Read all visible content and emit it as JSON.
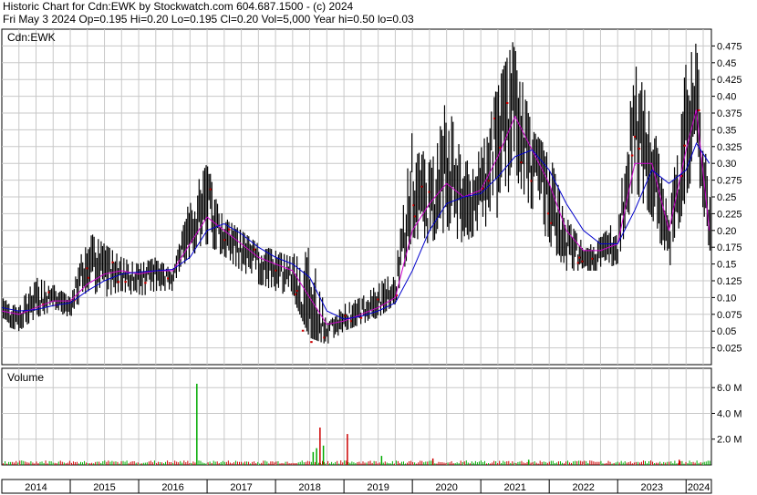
{
  "header": {
    "line1": "Historic Chart for Cdn:EWK by Stockwatch.com 604.687.1500 - (c) 2024",
    "line2": "Fri May  3 2024  Op=0.195  Hi=0.20  Lo=0.195  Cl=0.20  Vol=5,000  Year hi=0.50  lo=0.03"
  },
  "chart_data": [
    {
      "type": "line",
      "title": "",
      "symbol_label": "Cdn:EWK",
      "y_axis_side": "right",
      "ylim": [
        0,
        0.5
      ],
      "y_ticks": [
        0.025,
        0.05,
        0.075,
        0.1,
        0.125,
        0.15,
        0.175,
        0.2,
        0.225,
        0.25,
        0.275,
        0.3,
        0.325,
        0.35,
        0.375,
        0.4,
        0.425,
        0.45,
        0.475
      ],
      "y_tick_labels": [
        "0.025",
        "0.05",
        "0.075",
        "0.10",
        "0.125",
        "0.15",
        "0.175",
        "0.20",
        "0.225",
        "0.25",
        "0.275",
        "0.30",
        "0.325",
        "0.35",
        "0.375",
        "0.40",
        "0.425",
        "0.45",
        "0.475"
      ],
      "x": [
        2014.0,
        2014.25,
        2014.5,
        2014.75,
        2015.0,
        2015.25,
        2015.5,
        2015.75,
        2016.0,
        2016.25,
        2016.5,
        2016.75,
        2017.0,
        2017.25,
        2017.5,
        2017.75,
        2018.0,
        2018.25,
        2018.5,
        2018.75,
        2019.0,
        2019.25,
        2019.5,
        2019.75,
        2020.0,
        2020.25,
        2020.5,
        2020.75,
        2021.0,
        2021.25,
        2021.5,
        2021.75,
        2022.0,
        2022.25,
        2022.5,
        2022.75,
        2023.0,
        2023.25,
        2023.5,
        2023.75,
        2024.0,
        2024.15,
        2024.34
      ],
      "series": [
        {
          "kind": "price_bars",
          "high": [
            0.11,
            0.09,
            0.13,
            0.12,
            0.1,
            0.2,
            0.18,
            0.16,
            0.15,
            0.16,
            0.14,
            0.25,
            0.3,
            0.22,
            0.2,
            0.18,
            0.17,
            0.16,
            0.22,
            0.06,
            0.09,
            0.1,
            0.12,
            0.14,
            0.35,
            0.3,
            0.4,
            0.3,
            0.32,
            0.42,
            0.49,
            0.35,
            0.32,
            0.22,
            0.18,
            0.19,
            0.22,
            0.45,
            0.38,
            0.22,
            0.45,
            0.48,
            0.25
          ],
          "low": [
            0.06,
            0.05,
            0.07,
            0.08,
            0.07,
            0.11,
            0.1,
            0.11,
            0.1,
            0.11,
            0.11,
            0.16,
            0.18,
            0.16,
            0.14,
            0.12,
            0.11,
            0.1,
            0.04,
            0.03,
            0.05,
            0.06,
            0.07,
            0.09,
            0.19,
            0.18,
            0.2,
            0.18,
            0.2,
            0.22,
            0.28,
            0.23,
            0.18,
            0.14,
            0.14,
            0.14,
            0.15,
            0.26,
            0.22,
            0.14,
            0.25,
            0.3,
            0.17
          ],
          "close": [
            0.08,
            0.07,
            0.1,
            0.1,
            0.09,
            0.15,
            0.14,
            0.14,
            0.13,
            0.14,
            0.13,
            0.21,
            0.24,
            0.19,
            0.17,
            0.15,
            0.14,
            0.13,
            0.06,
            0.05,
            0.07,
            0.08,
            0.09,
            0.11,
            0.27,
            0.23,
            0.3,
            0.24,
            0.26,
            0.33,
            0.38,
            0.3,
            0.25,
            0.18,
            0.16,
            0.17,
            0.18,
            0.35,
            0.29,
            0.18,
            0.35,
            0.39,
            0.2
          ]
        },
        {
          "kind": "moving_average",
          "color": "#cc00cc",
          "values": [
            0.08,
            0.075,
            0.085,
            0.095,
            0.095,
            0.12,
            0.135,
            0.14,
            0.135,
            0.14,
            0.14,
            0.18,
            0.22,
            0.2,
            0.18,
            0.16,
            0.15,
            0.14,
            0.1,
            0.06,
            0.065,
            0.075,
            0.085,
            0.1,
            0.2,
            0.24,
            0.27,
            0.25,
            0.26,
            0.31,
            0.37,
            0.32,
            0.27,
            0.2,
            0.17,
            0.17,
            0.18,
            0.3,
            0.3,
            0.2,
            0.32,
            0.38,
            0.2
          ]
        },
        {
          "kind": "moving_average",
          "color": "#0000cc",
          "values": [
            0.085,
            0.08,
            0.082,
            0.088,
            0.092,
            0.11,
            0.125,
            0.135,
            0.138,
            0.14,
            0.142,
            0.16,
            0.2,
            0.21,
            0.195,
            0.175,
            0.16,
            0.15,
            0.13,
            0.08,
            0.068,
            0.072,
            0.08,
            0.092,
            0.14,
            0.2,
            0.24,
            0.25,
            0.255,
            0.28,
            0.31,
            0.32,
            0.29,
            0.24,
            0.2,
            0.18,
            0.18,
            0.23,
            0.29,
            0.27,
            0.29,
            0.33,
            0.3
          ]
        }
      ],
      "grid": true
    },
    {
      "type": "bar",
      "title": "Volume",
      "y_axis_side": "right",
      "ylim": [
        0,
        7.5
      ],
      "y_ticks": [
        2,
        4,
        6
      ],
      "y_tick_labels": [
        "2.0 M",
        "4.0 M",
        "6.0 M"
      ],
      "spikes": [
        {
          "x": 2016.85,
          "value": 6.3,
          "color": "#00aa00"
        },
        {
          "x": 2018.55,
          "value": 1.0,
          "color": "#00aa00"
        },
        {
          "x": 2018.6,
          "value": 1.3,
          "color": "#00aa00"
        },
        {
          "x": 2018.65,
          "value": 2.9,
          "color": "#cc0000"
        },
        {
          "x": 2018.7,
          "value": 1.5,
          "color": "#00aa00"
        },
        {
          "x": 2019.05,
          "value": 2.4,
          "color": "#cc0000"
        },
        {
          "x": 2019.55,
          "value": 0.7,
          "color": "#00aa00"
        },
        {
          "x": 2020.3,
          "value": 0.5,
          "color": "#cc0000"
        },
        {
          "x": 2021.7,
          "value": 0.4,
          "color": "#00aa00"
        },
        {
          "x": 2023.9,
          "value": 0.4,
          "color": "#cc0000"
        }
      ],
      "grid": true
    }
  ],
  "x_axis": {
    "year_labels": [
      "2014",
      "2015",
      "2016",
      "2017",
      "2018",
      "2019",
      "2020",
      "2021",
      "2022",
      "2023",
      "2024"
    ],
    "year_positions": [
      2014.0,
      2015.0,
      2016.0,
      2017.0,
      2018.0,
      2019.0,
      2020.0,
      2021.0,
      2022.0,
      2023.0,
      2024.0
    ]
  }
}
